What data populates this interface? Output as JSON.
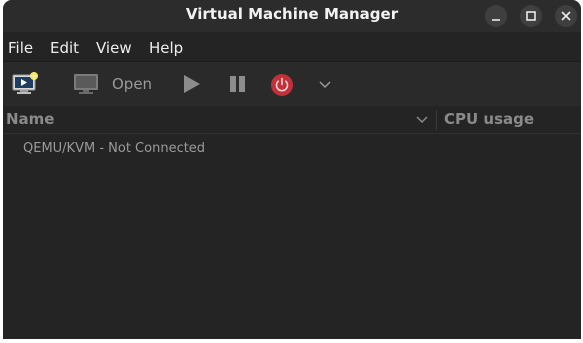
{
  "window": {
    "title": "Virtual Machine Manager"
  },
  "window_controls": [
    "minimize-icon",
    "maximize-icon",
    "close-icon"
  ],
  "menubar": {
    "items": [
      "File",
      "Edit",
      "View",
      "Help"
    ]
  },
  "toolbar": {
    "new_vm_icon": "new-vm-icon",
    "open_icon": "monitor-icon",
    "open_label": "Open",
    "run_icon": "play-icon",
    "pause_icon": "pause-icon",
    "shutdown_icon": "power-icon",
    "shutdown_color": "#c0313a",
    "more_icon": "chevron-down-icon"
  },
  "table": {
    "columns": [
      "Name",
      "CPU usage"
    ],
    "rows": [
      {
        "name": "QEMU/KVM - Not Connected"
      }
    ]
  }
}
